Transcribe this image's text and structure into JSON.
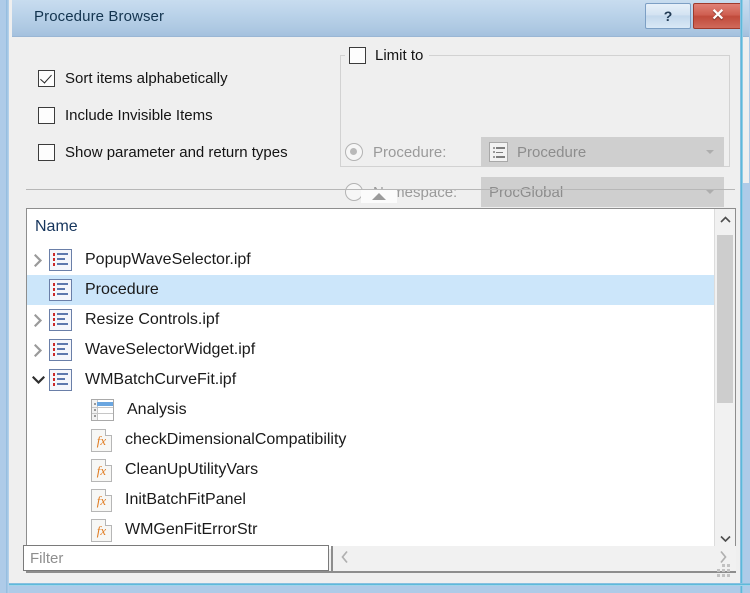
{
  "window": {
    "title": "Procedure Browser",
    "help_button_label": "?",
    "close_button_label": "✕",
    "accent_title_bg": "#b5cfe7",
    "close_button_color": "#c04a3b",
    "selection_color": "#cce6fa"
  },
  "options": {
    "checkboxes": [
      {
        "label": "Sort items alphabetically",
        "checked": true
      },
      {
        "label": "Include Invisible Items",
        "checked": false
      },
      {
        "label": "Show parameter and return types",
        "checked": false
      }
    ],
    "limit_group": {
      "title": "Limit to",
      "checked": false,
      "radios": [
        {
          "label": "Procedure:",
          "selected": true,
          "combo_value": "Procedure",
          "combo_icon": "procedure-file-icon"
        },
        {
          "label": "Namespace:",
          "selected": false,
          "combo_value": "ProcGlobal",
          "combo_icon": "none"
        }
      ]
    },
    "collapse_handle_icon": "triangle-up-icon"
  },
  "list": {
    "column_header": "Name",
    "rows": [
      {
        "label": "PopupWaveSelector.ipf",
        "icon": "procedure-file-icon",
        "twisty": "collapsed",
        "level": 0,
        "selected": false
      },
      {
        "label": "Procedure",
        "icon": "procedure-file-icon",
        "twisty": "none",
        "level": 0,
        "selected": true
      },
      {
        "label": "Resize Controls.ipf",
        "icon": "procedure-file-icon",
        "twisty": "collapsed",
        "level": 0,
        "selected": false
      },
      {
        "label": "WaveSelectorWidget.ipf",
        "icon": "procedure-file-icon",
        "twisty": "collapsed",
        "level": 0,
        "selected": false
      },
      {
        "label": "WMBatchCurveFit.ipf",
        "icon": "procedure-file-icon",
        "twisty": "expanded",
        "level": 0,
        "selected": false
      },
      {
        "label": "Analysis",
        "icon": "table-icon",
        "twisty": "none",
        "level": 1,
        "selected": false
      },
      {
        "label": "checkDimensionalCompatibility",
        "icon": "function-icon",
        "twisty": "none",
        "level": 1,
        "selected": false
      },
      {
        "label": "CleanUpUtilityVars",
        "icon": "function-icon",
        "twisty": "none",
        "level": 1,
        "selected": false
      },
      {
        "label": "InitBatchFitPanel",
        "icon": "function-icon",
        "twisty": "none",
        "level": 1,
        "selected": false
      },
      {
        "label": "WMGenFitErrorStr",
        "icon": "function-icon",
        "twisty": "none",
        "level": 1,
        "selected": false
      }
    ],
    "vertical_scrollbar": {
      "up_icon": "chevron-up-icon",
      "down_icon": "chevron-down-icon"
    }
  },
  "footer": {
    "filter_placeholder": "Filter",
    "filter_value": "",
    "hscroll_left_icon": "chevron-left-icon",
    "hscroll_right_icon": "chevron-right-icon",
    "resize_grip_icon": "resize-grip-icon"
  }
}
